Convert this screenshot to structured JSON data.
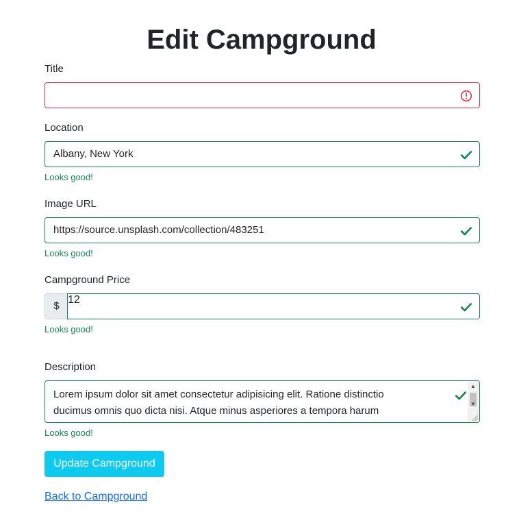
{
  "page": {
    "heading": "Edit Campground"
  },
  "form": {
    "title": {
      "label": "Title",
      "value": "",
      "state": "invalid"
    },
    "location": {
      "label": "Location",
      "value": "Albany, New York",
      "feedback": "Looks good!",
      "state": "valid"
    },
    "image": {
      "label": "Image URL",
      "value": "https://source.unsplash.com/collection/483251",
      "feedback": "Looks good!",
      "state": "valid"
    },
    "price": {
      "label": "Campground Price",
      "addon": "$",
      "value": "12",
      "feedback": "Looks good!",
      "state": "valid"
    },
    "description": {
      "label": "Description",
      "line1": "Lorem ipsum dolor sit amet consectetur adipisicing elit. Ratione distinctio",
      "line2": "ducimus omnis quo dicta nisi. Atque minus asperiores a tempora harum",
      "feedback": "Looks good!",
      "state": "valid"
    },
    "submit_label": "Update Campground",
    "back_link": "Back to Campground"
  },
  "icons": {
    "invalid": "exclamation-circle-icon",
    "valid": "check-icon"
  },
  "colors": {
    "valid": "#198754",
    "invalid": "#dc3545",
    "button": "#0dcaf0",
    "link": "#0d6efd"
  }
}
